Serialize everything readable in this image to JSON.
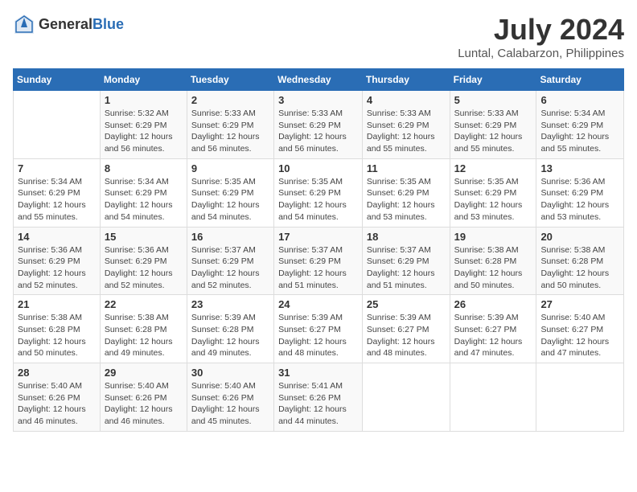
{
  "header": {
    "logo": {
      "general": "General",
      "blue": "Blue"
    },
    "title": "July 2024",
    "location": "Luntal, Calabarzon, Philippines"
  },
  "columns": [
    "Sunday",
    "Monday",
    "Tuesday",
    "Wednesday",
    "Thursday",
    "Friday",
    "Saturday"
  ],
  "weeks": [
    {
      "days": [
        {
          "num": "",
          "info": ""
        },
        {
          "num": "1",
          "info": "Sunrise: 5:32 AM\nSunset: 6:29 PM\nDaylight: 12 hours\nand 56 minutes."
        },
        {
          "num": "2",
          "info": "Sunrise: 5:33 AM\nSunset: 6:29 PM\nDaylight: 12 hours\nand 56 minutes."
        },
        {
          "num": "3",
          "info": "Sunrise: 5:33 AM\nSunset: 6:29 PM\nDaylight: 12 hours\nand 56 minutes."
        },
        {
          "num": "4",
          "info": "Sunrise: 5:33 AM\nSunset: 6:29 PM\nDaylight: 12 hours\nand 55 minutes."
        },
        {
          "num": "5",
          "info": "Sunrise: 5:33 AM\nSunset: 6:29 PM\nDaylight: 12 hours\nand 55 minutes."
        },
        {
          "num": "6",
          "info": "Sunrise: 5:34 AM\nSunset: 6:29 PM\nDaylight: 12 hours\nand 55 minutes."
        }
      ]
    },
    {
      "days": [
        {
          "num": "7",
          "info": "Sunrise: 5:34 AM\nSunset: 6:29 PM\nDaylight: 12 hours\nand 55 minutes."
        },
        {
          "num": "8",
          "info": "Sunrise: 5:34 AM\nSunset: 6:29 PM\nDaylight: 12 hours\nand 54 minutes."
        },
        {
          "num": "9",
          "info": "Sunrise: 5:35 AM\nSunset: 6:29 PM\nDaylight: 12 hours\nand 54 minutes."
        },
        {
          "num": "10",
          "info": "Sunrise: 5:35 AM\nSunset: 6:29 PM\nDaylight: 12 hours\nand 54 minutes."
        },
        {
          "num": "11",
          "info": "Sunrise: 5:35 AM\nSunset: 6:29 PM\nDaylight: 12 hours\nand 53 minutes."
        },
        {
          "num": "12",
          "info": "Sunrise: 5:35 AM\nSunset: 6:29 PM\nDaylight: 12 hours\nand 53 minutes."
        },
        {
          "num": "13",
          "info": "Sunrise: 5:36 AM\nSunset: 6:29 PM\nDaylight: 12 hours\nand 53 minutes."
        }
      ]
    },
    {
      "days": [
        {
          "num": "14",
          "info": "Sunrise: 5:36 AM\nSunset: 6:29 PM\nDaylight: 12 hours\nand 52 minutes."
        },
        {
          "num": "15",
          "info": "Sunrise: 5:36 AM\nSunset: 6:29 PM\nDaylight: 12 hours\nand 52 minutes."
        },
        {
          "num": "16",
          "info": "Sunrise: 5:37 AM\nSunset: 6:29 PM\nDaylight: 12 hours\nand 52 minutes."
        },
        {
          "num": "17",
          "info": "Sunrise: 5:37 AM\nSunset: 6:29 PM\nDaylight: 12 hours\nand 51 minutes."
        },
        {
          "num": "18",
          "info": "Sunrise: 5:37 AM\nSunset: 6:29 PM\nDaylight: 12 hours\nand 51 minutes."
        },
        {
          "num": "19",
          "info": "Sunrise: 5:38 AM\nSunset: 6:28 PM\nDaylight: 12 hours\nand 50 minutes."
        },
        {
          "num": "20",
          "info": "Sunrise: 5:38 AM\nSunset: 6:28 PM\nDaylight: 12 hours\nand 50 minutes."
        }
      ]
    },
    {
      "days": [
        {
          "num": "21",
          "info": "Sunrise: 5:38 AM\nSunset: 6:28 PM\nDaylight: 12 hours\nand 50 minutes."
        },
        {
          "num": "22",
          "info": "Sunrise: 5:38 AM\nSunset: 6:28 PM\nDaylight: 12 hours\nand 49 minutes."
        },
        {
          "num": "23",
          "info": "Sunrise: 5:39 AM\nSunset: 6:28 PM\nDaylight: 12 hours\nand 49 minutes."
        },
        {
          "num": "24",
          "info": "Sunrise: 5:39 AM\nSunset: 6:27 PM\nDaylight: 12 hours\nand 48 minutes."
        },
        {
          "num": "25",
          "info": "Sunrise: 5:39 AM\nSunset: 6:27 PM\nDaylight: 12 hours\nand 48 minutes."
        },
        {
          "num": "26",
          "info": "Sunrise: 5:39 AM\nSunset: 6:27 PM\nDaylight: 12 hours\nand 47 minutes."
        },
        {
          "num": "27",
          "info": "Sunrise: 5:40 AM\nSunset: 6:27 PM\nDaylight: 12 hours\nand 47 minutes."
        }
      ]
    },
    {
      "days": [
        {
          "num": "28",
          "info": "Sunrise: 5:40 AM\nSunset: 6:26 PM\nDaylight: 12 hours\nand 46 minutes."
        },
        {
          "num": "29",
          "info": "Sunrise: 5:40 AM\nSunset: 6:26 PM\nDaylight: 12 hours\nand 46 minutes."
        },
        {
          "num": "30",
          "info": "Sunrise: 5:40 AM\nSunset: 6:26 PM\nDaylight: 12 hours\nand 45 minutes."
        },
        {
          "num": "31",
          "info": "Sunrise: 5:41 AM\nSunset: 6:26 PM\nDaylight: 12 hours\nand 44 minutes."
        },
        {
          "num": "",
          "info": ""
        },
        {
          "num": "",
          "info": ""
        },
        {
          "num": "",
          "info": ""
        }
      ]
    }
  ]
}
